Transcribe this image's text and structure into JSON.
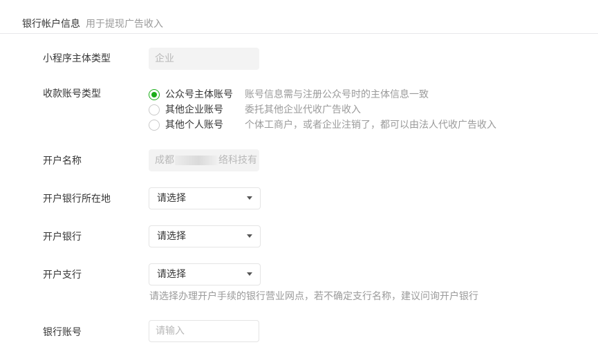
{
  "header": {
    "title": "银行帐户信息",
    "subtitle": "用于提现广告收入"
  },
  "form": {
    "program_type": {
      "label": "小程序主体类型",
      "value": "企业"
    },
    "account_type": {
      "label": "收款账号类型",
      "options": [
        {
          "label": "公众号主体账号",
          "desc": "账号信息需与注册公众号时的主体信息一致",
          "checked": true
        },
        {
          "label": "其他企业账号",
          "desc": "委托其他企业代收广告收入",
          "checked": false
        },
        {
          "label": "其他个人账号",
          "desc": "个体工商户，或者企业注销了，都可以由法人代收广告收入",
          "checked": false
        }
      ]
    },
    "account_name": {
      "label": "开户名称",
      "value_prefix": "成都",
      "value_suffix": "络科技有"
    },
    "bank_location": {
      "label": "开户银行所在地",
      "value": "请选择"
    },
    "bank": {
      "label": "开户银行",
      "value": "请选择"
    },
    "branch": {
      "label": "开户支行",
      "value": "请选择",
      "tip": "请选择办理开户手续的银行营业网点，若不确定支行名称，建议问询开户银行"
    },
    "account_number": {
      "label": "银行账号",
      "placeholder": "请输入"
    }
  },
  "colors": {
    "accent": "#1aad19",
    "text": "#353535",
    "muted": "#9a9a9a",
    "disabled_bg": "#f3f3f3",
    "border": "#e4e4e4"
  }
}
